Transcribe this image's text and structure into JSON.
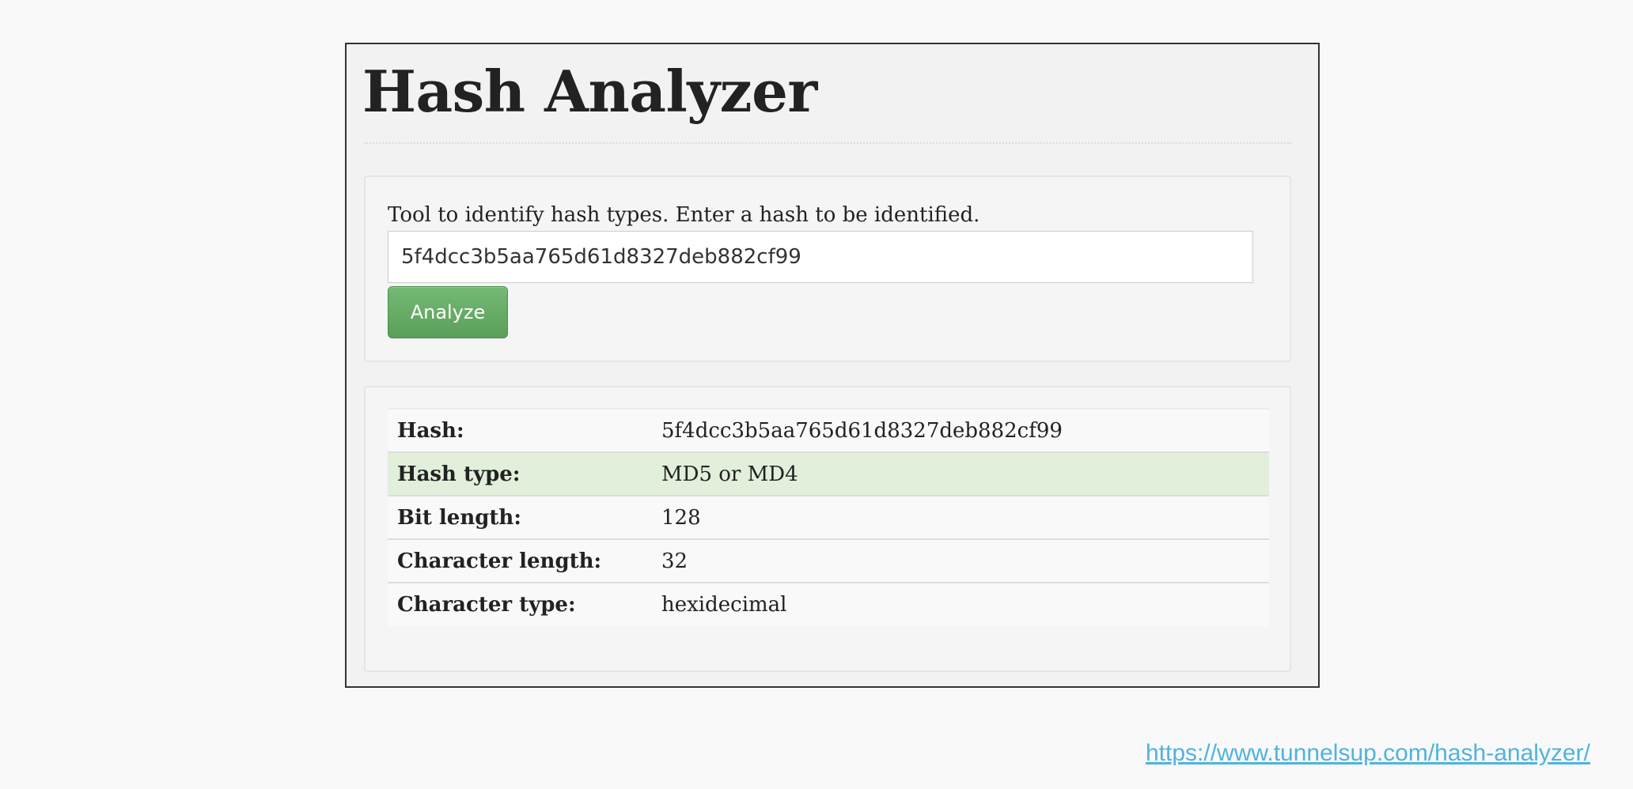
{
  "page": {
    "title": "Hash Analyzer"
  },
  "form": {
    "instructions": "Tool to identify hash types. Enter a hash to be identified.",
    "hash_value": "5f4dcc3b5aa765d61d8327deb882cf99",
    "analyze_label": "Analyze"
  },
  "results": {
    "rows": [
      {
        "label": "Hash:",
        "value": "5f4dcc3b5aa765d61d8327deb882cf99"
      },
      {
        "label": "Hash type:",
        "value": "MD5 or MD4"
      },
      {
        "label": "Bit length:",
        "value": "128"
      },
      {
        "label": "Character length:",
        "value": "32"
      },
      {
        "label": "Character type:",
        "value": "hexidecimal"
      }
    ]
  },
  "footer": {
    "link_text": "https://www.tunnelsup.com/hash-analyzer/"
  },
  "colors": {
    "button_green": "#5cb85c",
    "highlight_row": "#e2efdb",
    "link_blue": "#4fb3e0"
  }
}
